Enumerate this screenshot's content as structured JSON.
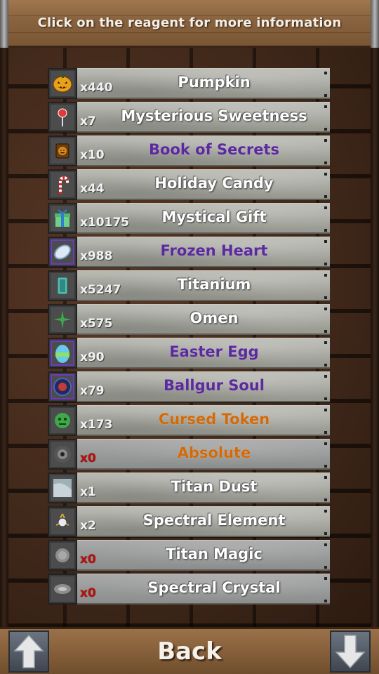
{
  "header": {
    "title": "Click on the reagent for more information"
  },
  "reagents": [
    {
      "name": "Pumpkin",
      "count": "x440",
      "name_color": "white",
      "icon": "pumpkin-icon"
    },
    {
      "name": "Mysterious Sweetness",
      "count": "x7",
      "name_color": "white",
      "icon": "lollipop-icon"
    },
    {
      "name": "Book of Secrets",
      "count": "x10",
      "name_color": "purple",
      "icon": "book-icon"
    },
    {
      "name": "Holiday Candy",
      "count": "x44",
      "name_color": "white",
      "icon": "candy-cane-icon"
    },
    {
      "name": "Mystical Gift",
      "count": "x10175",
      "name_color": "white",
      "icon": "gift-icon"
    },
    {
      "name": "Frozen Heart",
      "count": "x988",
      "name_color": "purple",
      "icon": "frozen-heart-icon"
    },
    {
      "name": "Titanium",
      "count": "x5247",
      "name_color": "white",
      "icon": "titanium-icon"
    },
    {
      "name": "Omen",
      "count": "x575",
      "name_color": "white",
      "icon": "omen-icon"
    },
    {
      "name": "Easter Egg",
      "count": "x90",
      "name_color": "purple",
      "icon": "easter-egg-icon"
    },
    {
      "name": "Ballgur Soul",
      "count": "x79",
      "name_color": "purple",
      "icon": "soul-orb-icon"
    },
    {
      "name": "Cursed Token",
      "count": "x173",
      "name_color": "orange",
      "icon": "cursed-token-icon"
    },
    {
      "name": "Absolute",
      "count": "x0",
      "name_color": "orange",
      "icon": "absolute-icon"
    },
    {
      "name": "Titan Dust",
      "count": "x1",
      "name_color": "white",
      "icon": "dust-icon"
    },
    {
      "name": "Spectral Element",
      "count": "x2",
      "name_color": "white",
      "icon": "spectral-element-icon"
    },
    {
      "name": "Titan Magic",
      "count": "x0",
      "name_color": "white",
      "icon": "titan-magic-icon"
    },
    {
      "name": "Spectral Crystal",
      "count": "x0",
      "name_color": "white",
      "icon": "spectral-crystal-icon"
    }
  ],
  "footer": {
    "back_label": "Back",
    "up_icon": "arrow-up-icon",
    "down_icon": "arrow-down-icon"
  },
  "colors": {
    "purple": "#5b2a9c",
    "orange": "#d06a0c",
    "zero_count": "#b4120f"
  }
}
